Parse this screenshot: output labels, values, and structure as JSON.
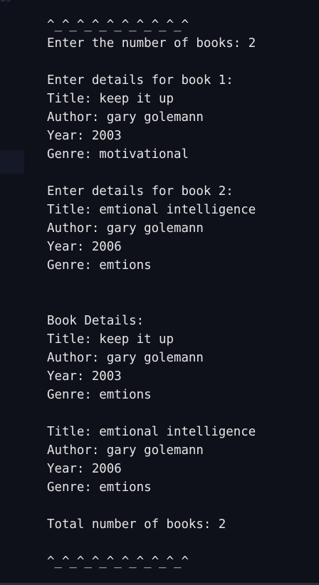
{
  "top_fragment": "ds",
  "lines": [
    "^_^_^_^_^_^_^_^_^_^",
    "Enter the number of books: 2",
    "",
    "Enter details for book 1:",
    "Title: keep it up",
    "Author: gary golemann",
    "Year: 2003",
    "Genre: motivational",
    "",
    "Enter details for book 2:",
    "Title: emtional intelligence",
    "Author: gary golemann",
    "Year: 2006",
    "Genre: emtions",
    "",
    "",
    "Book Details:",
    "Title: keep it up",
    "Author: gary golemann",
    "Year: 2003",
    "Genre: emtions",
    "",
    "Title: emtional intelligence",
    "Author: gary golemann",
    "Year: 2006",
    "Genre: emtions",
    "",
    "Total number of books: 2",
    "",
    "^_^_^_^_^_^_^_^_^_^"
  ]
}
